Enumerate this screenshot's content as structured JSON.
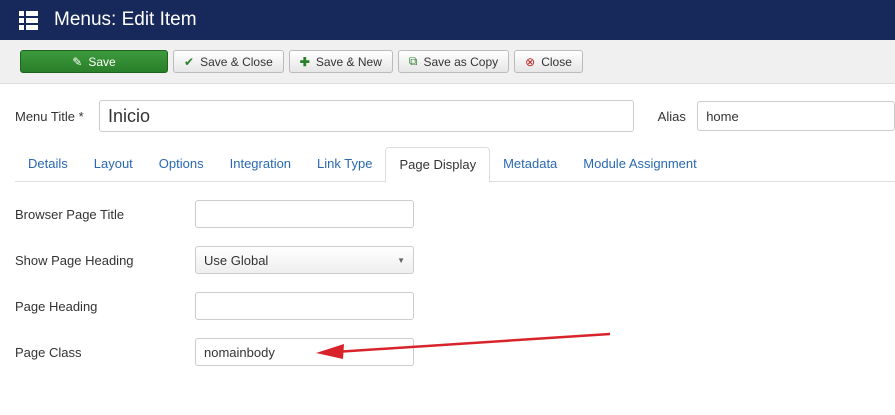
{
  "header": {
    "title": "Menus: Edit Item",
    "icon": "list-icon"
  },
  "toolbar": {
    "save": "Save",
    "save_close": "Save & Close",
    "save_new": "Save & New",
    "save_copy": "Save as Copy",
    "close": "Close"
  },
  "menu_title": {
    "label": "Menu Title *",
    "value": "Inicio"
  },
  "alias": {
    "label": "Alias",
    "value": "home"
  },
  "tabs": [
    "Details",
    "Layout",
    "Options",
    "Integration",
    "Link Type",
    "Page Display",
    "Metadata",
    "Module Assignment"
  ],
  "active_tab": "Page Display",
  "fields": {
    "browser_title": {
      "label": "Browser Page Title",
      "value": ""
    },
    "show_heading": {
      "label": "Show Page Heading",
      "value": "Use Global"
    },
    "page_heading": {
      "label": "Page Heading",
      "value": ""
    },
    "page_class": {
      "label": "Page Class",
      "value": "nomainbody"
    }
  },
  "colors": {
    "header": "#17285a",
    "save": "#2f892f",
    "arrow": "#d9232a"
  }
}
